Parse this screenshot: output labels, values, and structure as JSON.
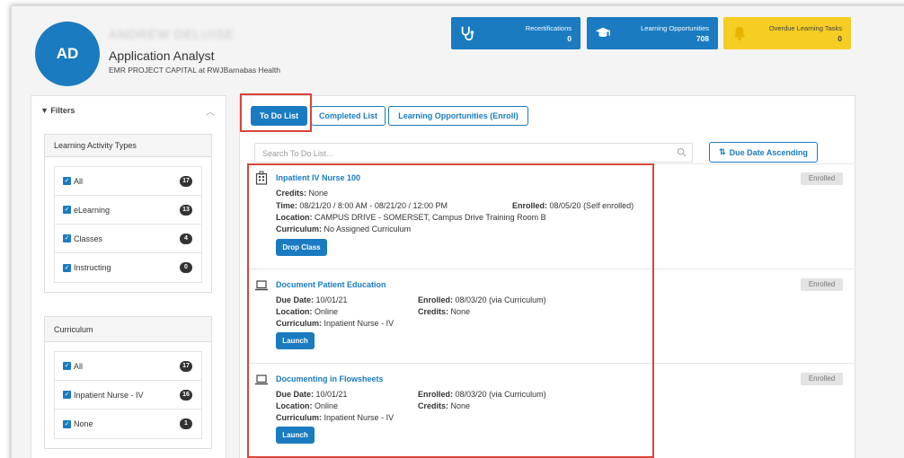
{
  "profile": {
    "initials": "AD",
    "name": "ANDREW DELUISE",
    "role": "Application Analyst",
    "org": "EMR PROJECT CAPITAL at RWJBarnabas Health"
  },
  "tiles": [
    {
      "label": "Recertifications",
      "count": "0",
      "icon": "stethoscope-icon",
      "color": "#1a7bc1"
    },
    {
      "label": "Learning Opportunities",
      "count": "708",
      "icon": "graduation-cap-icon",
      "color": "#1a7bc1"
    },
    {
      "label": "Overdue Learning Tasks",
      "count": "0",
      "icon": "bell-icon",
      "color": "#f6cd23"
    }
  ],
  "filters": {
    "title": "Filters",
    "activity_types": {
      "title": "Learning Activity Types",
      "items": [
        {
          "label": "All",
          "count": "17"
        },
        {
          "label": "eLearning",
          "count": "13"
        },
        {
          "label": "Classes",
          "count": "4"
        },
        {
          "label": "Instructing",
          "count": "0"
        }
      ]
    },
    "curriculum": {
      "title": "Curriculum",
      "items": [
        {
          "label": "All",
          "count": "17"
        },
        {
          "label": "Inpatient Nurse - IV",
          "count": "16"
        },
        {
          "label": "None",
          "count": "1"
        }
      ]
    }
  },
  "tabs": [
    {
      "label": "To Do List",
      "active": true
    },
    {
      "label": "Completed List",
      "active": false
    },
    {
      "label": "Learning Opportunities (Enroll)",
      "active": false
    }
  ],
  "search": {
    "placeholder": "Search To Do List..."
  },
  "sort": {
    "label": "Due Date Ascending"
  },
  "items": [
    {
      "title": "Inpatient IV Nurse 100",
      "icon": "building-icon",
      "credits_label": "Credits:",
      "credits": "None",
      "time_label": "Time:",
      "time": "08/21/20 / 8:00 AM - 08/21/20 / 12:00 PM",
      "enrolled_label": "Enrolled:",
      "enrolled": "08/05/20 (Self enrolled)",
      "location_label": "Location:",
      "location": "CAMPUS DRIVE - SOMERSET, Campus Drive Training Room B",
      "curriculum_label": "Curriculum:",
      "curriculum": "No Assigned Curriculum",
      "action": "Drop Class",
      "status": "Enrolled"
    },
    {
      "title": "Document Patient Education",
      "icon": "laptop-icon",
      "due_label": "Due Date:",
      "due": "10/01/21",
      "enrolled_label": "Enrolled:",
      "enrolled": "08/03/20 (via Curriculum)",
      "location_label": "Location:",
      "location": "Online",
      "credits_label": "Credits:",
      "credits": "None",
      "curriculum_label": "Curriculum:",
      "curriculum": "Inpatient Nurse - IV",
      "action": "Launch",
      "status": "Enrolled"
    },
    {
      "title": "Documenting in Flowsheets",
      "icon": "laptop-icon",
      "due_label": "Due Date:",
      "due": "10/01/21",
      "enrolled_label": "Enrolled:",
      "enrolled": "08/03/20 (via Curriculum)",
      "location_label": "Location:",
      "location": "Online",
      "credits_label": "Credits:",
      "credits": "None",
      "curriculum_label": "Curriculum:",
      "curriculum": "Inpatient Nurse - IV",
      "action": "Launch",
      "status": "Enrolled"
    }
  ]
}
